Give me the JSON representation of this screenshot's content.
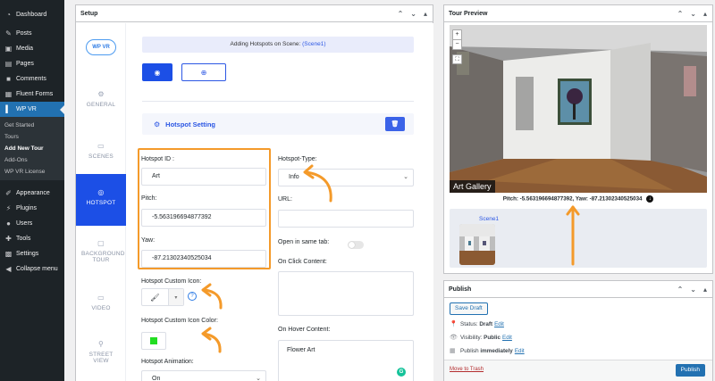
{
  "admin_menu": {
    "items": [
      {
        "label": "Dashboard",
        "icon": "dashboard-icon"
      },
      {
        "label": "Posts",
        "icon": "pin-icon"
      },
      {
        "label": "Media",
        "icon": "media-icon"
      },
      {
        "label": "Pages",
        "icon": "page-icon"
      },
      {
        "label": "Comments",
        "icon": "comment-icon"
      },
      {
        "label": "Fluent Forms",
        "icon": "form-icon"
      },
      {
        "label": "WP VR",
        "icon": "vr-icon"
      }
    ],
    "submenu": [
      "Get Started",
      "Tours",
      "Add New Tour",
      "Add-Ons",
      "WP VR License"
    ],
    "items2": [
      {
        "label": "Appearance",
        "icon": "brush-icon"
      },
      {
        "label": "Plugins",
        "icon": "plugin-icon"
      },
      {
        "label": "Users",
        "icon": "user-icon"
      },
      {
        "label": "Tools",
        "icon": "wrench-icon"
      },
      {
        "label": "Settings",
        "icon": "settings-icon"
      },
      {
        "label": "Collapse menu",
        "icon": "collapse-icon"
      }
    ]
  },
  "setup": {
    "title": "Setup",
    "logo_text": "WP VR",
    "nav": [
      {
        "label": "GENERAL",
        "icon": "gear-icon"
      },
      {
        "label": "SCENES",
        "icon": "image-icon"
      },
      {
        "label": "HOTSPOT",
        "icon": "target-icon"
      },
      {
        "label": "BACKGROUND TOUR",
        "icon": "video-icon"
      },
      {
        "label": "VIDEO",
        "icon": "video-camera-icon"
      },
      {
        "label": "STREET VIEW",
        "icon": "street-view-icon"
      }
    ],
    "banner_prefix": "Adding Hotspots on Scene:",
    "banner_scene": "(Scene1)",
    "hotspot_setting_title": "Hotspot Setting",
    "fields": {
      "hotspot_id_label": "Hotspot ID :",
      "hotspot_id_value": "Art",
      "pitch_label": "Pitch:",
      "pitch_value": "-5.563196694877392",
      "yaw_label": "Yaw:",
      "yaw_value": "-87.21302340525034",
      "custom_icon_label": "Hotspot Custom Icon:",
      "custom_icon_color_label": "Hotspot Custom Icon Color:",
      "animation_label": "Hotspot Animation:",
      "animation_value": "On",
      "type_label": "Hotspot-Type:",
      "type_value": "Info",
      "url_label": "URL:",
      "open_same_tab_label": "Open in same tab:",
      "on_click_label": "On Click Content:",
      "on_hover_label": "On Hover Content:",
      "on_hover_value": "Flower Art",
      "icon_color": "#22dd22"
    }
  },
  "preview": {
    "title": "Tour Preview",
    "zoom_in": "+",
    "zoom_out": "−",
    "pano_title": "Art Gallery",
    "pitch_yaw_text": "Pitch: -5.563196694877392, Yaw: -87.21302340525034",
    "scene_label": "Scene1"
  },
  "publish": {
    "title": "Publish",
    "save_draft": "Save Draft",
    "status_label": "Status:",
    "status_value": "Draft",
    "visibility_label": "Visibility:",
    "visibility_value": "Public",
    "publish_label": "Publish",
    "publish_value": "immediately",
    "edit": "Edit",
    "move_to_trash": "Move to Trash",
    "publish_button": "Publish"
  },
  "colors": {
    "accent": "#1c4fe6",
    "annotation": "#f49a2a",
    "wp_blue": "#2271b1"
  }
}
